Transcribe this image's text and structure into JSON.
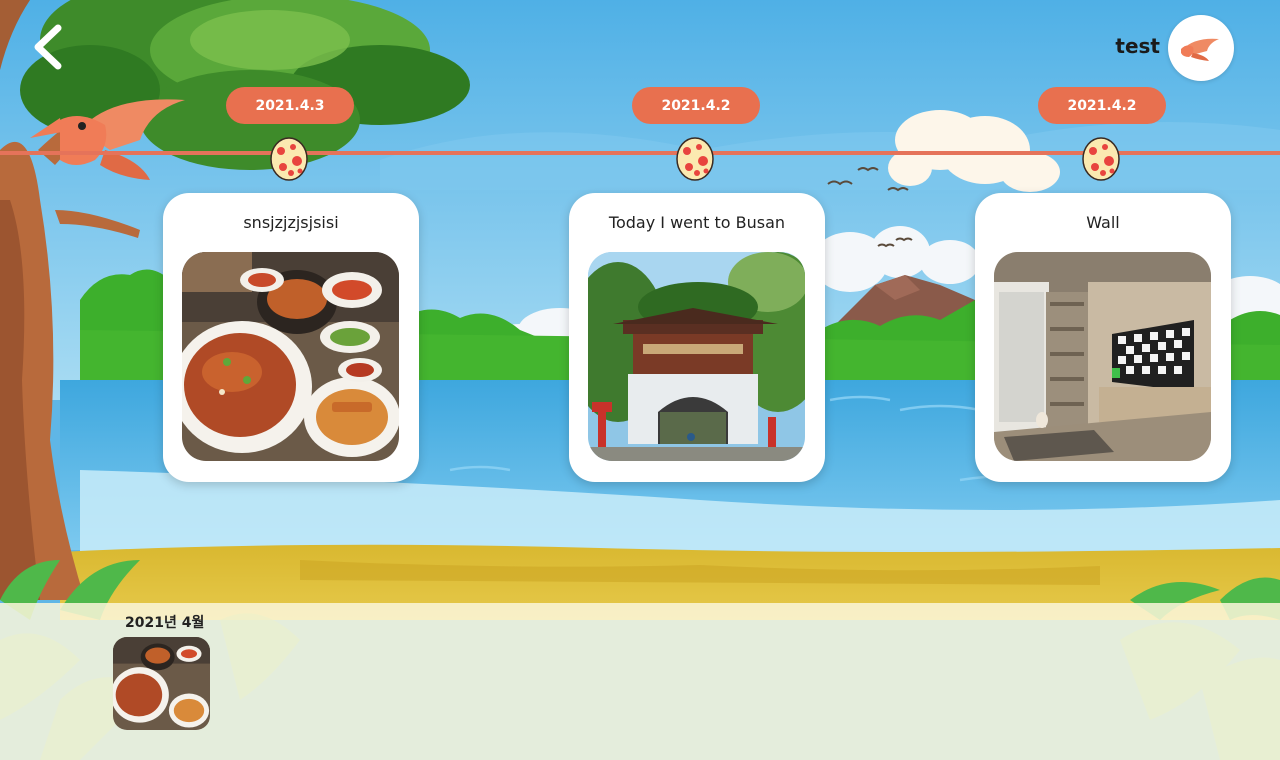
{
  "header": {
    "back_icon": "chevron-left-icon",
    "user_name": "test",
    "avatar_icon": "pterodactyl-icon"
  },
  "timeline": {
    "line_color": "#e5735a",
    "accent_color": "#e8704f",
    "entries": [
      {
        "date": "2021.4.3",
        "title": "snsjzjzjsjsisi",
        "photo": "korean-food-photo"
      },
      {
        "date": "2021.4.2",
        "title": "Today I went to Busan",
        "photo": "temple-gate-photo"
      },
      {
        "date": "2021.4.2",
        "title": "Wall",
        "photo": "living-room-photo"
      }
    ]
  },
  "archive": {
    "month_label": "2021년 4월",
    "thumbnails": [
      {
        "photo": "korean-food-photo"
      }
    ]
  }
}
